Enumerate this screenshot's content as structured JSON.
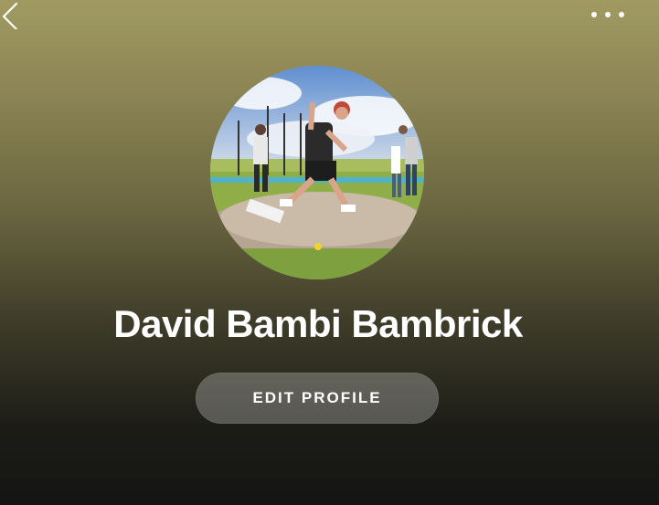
{
  "header": {
    "back_icon": "chevron-left-icon",
    "more_icon": "more-horizontal-icon"
  },
  "profile": {
    "avatar_alt": "Profile photo",
    "name": "David Bambi Bambrick",
    "edit_label": "EDIT PROFILE"
  },
  "colors": {
    "background_top": "#a09a62",
    "background_bottom": "#141414",
    "text": "#ffffff",
    "button_fill": "rgba(255,255,255,0.26)"
  }
}
